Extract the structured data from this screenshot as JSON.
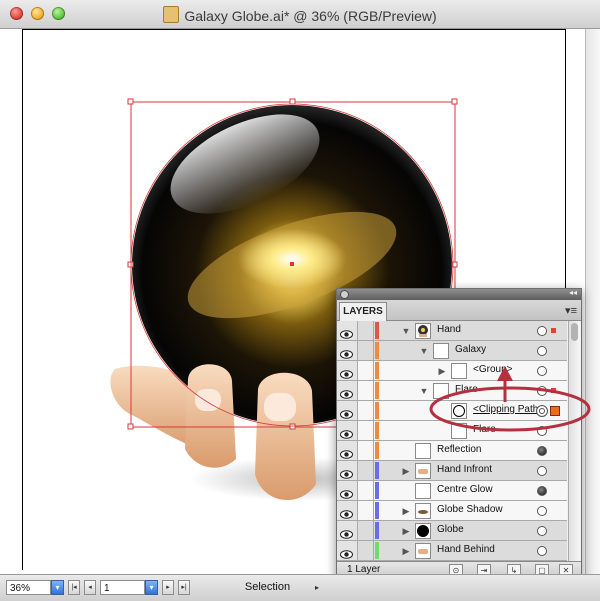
{
  "window": {
    "title": "Galaxy Globe.ai* @ 36% (RGB/Preview)"
  },
  "status": {
    "zoom": "36%",
    "page": "1",
    "tool": "Selection"
  },
  "panel": {
    "tab": "LAYERS",
    "footer": "1 Layer",
    "layers": [
      {
        "name": "Hand",
        "tone": "alt",
        "indent": 0,
        "expand": "open",
        "thumb": "globe",
        "color": "#e55349",
        "target": "ring-outline",
        "selected": "small"
      },
      {
        "name": "Galaxy",
        "tone": "alt",
        "indent": 1,
        "expand": "open",
        "thumb": "white",
        "color": "#f08a3c",
        "target": "outline",
        "selected": ""
      },
      {
        "name": "<Group>",
        "tone": "plain",
        "indent": 2,
        "expand": "closed",
        "thumb": "white",
        "color": "#f08a3c",
        "target": "outline",
        "selected": ""
      },
      {
        "name": "Flare",
        "tone": "plain",
        "indent": 1,
        "expand": "open",
        "thumb": "white",
        "color": "#f08a3c",
        "target": "outline",
        "selected": "small"
      },
      {
        "name": "<Clipping Path>",
        "tone": "plain",
        "indent": 2,
        "expand": "",
        "thumb": "circle",
        "color": "#f08a3c",
        "target": "ring",
        "selected": "big",
        "clip": true
      },
      {
        "name": "Flare",
        "tone": "plain",
        "indent": 2,
        "expand": "",
        "thumb": "white",
        "color": "#f08a3c",
        "target": "outline",
        "selected": ""
      },
      {
        "name": "Reflection",
        "tone": "plain",
        "indent": 0,
        "expand": "",
        "thumb": "white",
        "color": "#f08a3c",
        "target": "filled",
        "selected": ""
      },
      {
        "name": "Hand Infront",
        "tone": "alt",
        "indent": 0,
        "expand": "closed",
        "thumb": "hand",
        "color": "#6b6bf0",
        "target": "outline",
        "selected": ""
      },
      {
        "name": "Centre Glow",
        "tone": "plain",
        "indent": 0,
        "expand": "",
        "thumb": "white",
        "color": "#6b6bf0",
        "target": "filled",
        "selected": ""
      },
      {
        "name": "Globe Shadow",
        "tone": "plain",
        "indent": 0,
        "expand": "closed",
        "thumb": "shadow",
        "color": "#6b6bf0",
        "target": "outline",
        "selected": ""
      },
      {
        "name": "Globe",
        "tone": "alt",
        "indent": 0,
        "expand": "closed",
        "thumb": "black",
        "color": "#6b6bf0",
        "target": "outline",
        "selected": ""
      },
      {
        "name": "Hand Behind",
        "tone": "alt",
        "indent": 0,
        "expand": "closed",
        "thumb": "hand",
        "color": "#6fdc6f",
        "target": "outline",
        "selected": ""
      }
    ]
  },
  "colors": {
    "selection": "#d43a3a",
    "annotation": "#b5303e",
    "canvas": "#ffffff"
  }
}
